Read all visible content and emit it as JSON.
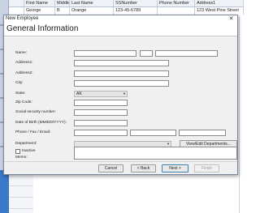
{
  "background_grid": {
    "columns": [
      "First Name",
      "Middle",
      "Last Name",
      "SSNumber",
      "Phone Number",
      "Address1"
    ],
    "row": [
      "George",
      "B",
      "Orange",
      "123-45-6789",
      "",
      "123 West Pine Street"
    ]
  },
  "dialog": {
    "window_title": "New Employee",
    "close_glyph": "✕",
    "header": "General Information"
  },
  "form": {
    "name_label": "Name:",
    "address1_label": "Address1:",
    "address2_label": "Address2:",
    "city_label": "City:",
    "state_label": "State:",
    "state_value": "AK",
    "zip_label": "Zip Code:",
    "ssn_label": "Social security number:",
    "dob_label": "Date of Birth (MM/DD/YYYY):",
    "phone_label": "Phone / Fax / Email:",
    "department_label": "Department:",
    "view_departments_label": "View/Edit Departments...",
    "inactive_label": "Inactive",
    "memo_label": "Memo:"
  },
  "buttons": {
    "cancel": "Cancel",
    "back": "< Back",
    "next": "Next >",
    "finish": "Finish"
  },
  "icons": {
    "dropdown": "chevron-down-icon",
    "close": "close-icon",
    "resize_grip": "resize-grip-icon"
  },
  "colors": {
    "dialog_bg": "#f0f0f0",
    "accent_blue": "#3a78c8"
  }
}
